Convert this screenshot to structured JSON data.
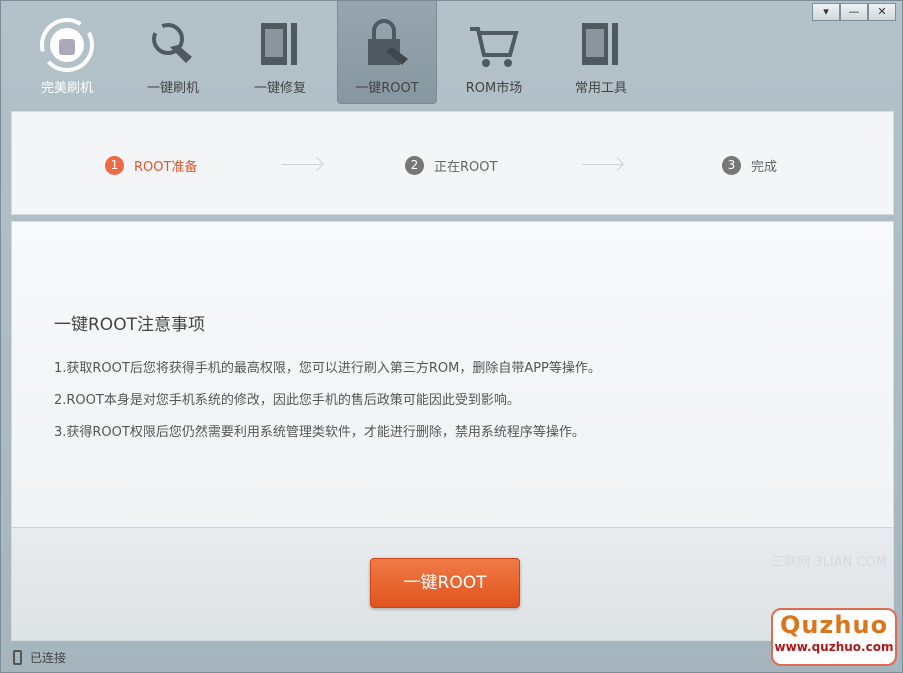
{
  "nav": [
    {
      "label": "完美刷机",
      "icon": "android-refresh-icon"
    },
    {
      "label": "一键刷机",
      "icon": "tap-refresh-icon"
    },
    {
      "label": "一键修复",
      "icon": "phone-wrench-icon"
    },
    {
      "label": "一键ROOT",
      "icon": "lock-tap-icon"
    },
    {
      "label": "ROM市场",
      "icon": "cart-icon"
    },
    {
      "label": "常用工具",
      "icon": "tools-icon"
    }
  ],
  "window": {
    "menu": "▾",
    "minimize": "—",
    "close": "✕"
  },
  "steps": [
    {
      "num": "1",
      "label": "ROOT准备"
    },
    {
      "num": "2",
      "label": "正在ROOT"
    },
    {
      "num": "3",
      "label": "完成"
    }
  ],
  "notice": {
    "title": "一键ROOT注意事项",
    "items": [
      "1.获取ROOT后您将获得手机的最高权限，您可以进行刷入第三方ROM，删除自带APP等操作。",
      "2.ROOT本身是对您手机系统的修改，因此您手机的售后政策可能因此受到影响。",
      "3.获得ROOT权限后您仍然需要利用系统管理类软件，才能进行删除，禁用系统程序等操作。"
    ]
  },
  "root_button": "一键ROOT",
  "watermark": "三联网 3LIAN.COM",
  "status": "已连接",
  "logo": {
    "title": "Quzhuo",
    "url": "www.quzhuo.com"
  }
}
